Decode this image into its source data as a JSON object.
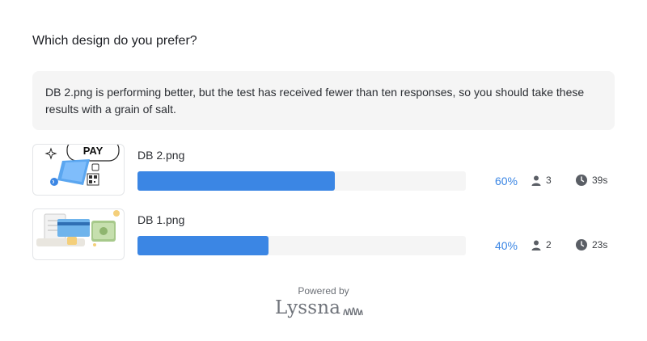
{
  "question": "Which design do you prefer?",
  "notice": "DB 2.png is performing better, but the test has received fewer than ten responses, so you should take these results with a grain of salt.",
  "results": [
    {
      "name": "DB 2.png",
      "percent": 60,
      "percent_label": "60%",
      "responses": "3",
      "avg_time": "39s",
      "thumbnail_text": "PAY",
      "thumbnail_icon": "payment-card-icon"
    },
    {
      "name": "DB 1.png",
      "percent": 40,
      "percent_label": "40%",
      "responses": "2",
      "avg_time": "23s",
      "thumbnail_icon": "money-card-icon"
    }
  ],
  "footer": {
    "powered_by": "Powered by",
    "brand": "Lyssna"
  },
  "colors": {
    "bar": "#3b86e4",
    "track": "#f5f5f5",
    "notice_bg": "#f5f5f5",
    "percent_text": "#3b86e4"
  },
  "icons": {
    "responses": "user-icon",
    "time": "clock-icon"
  }
}
